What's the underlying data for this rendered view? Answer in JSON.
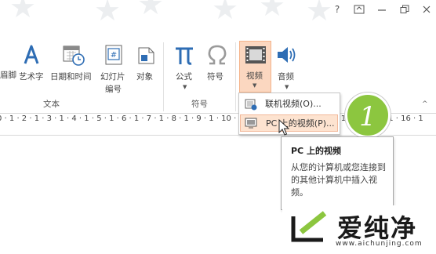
{
  "window": {
    "help": "?"
  },
  "ribbon": {
    "items": [
      {
        "label": "眉脚"
      },
      {
        "label": "艺术字"
      },
      {
        "label": "日期和时间"
      },
      {
        "label_line1": "幻灯片",
        "label_line2": "编号"
      },
      {
        "label": "对象"
      },
      {
        "label": "公式"
      },
      {
        "label": "符号"
      },
      {
        "label": "视频"
      },
      {
        "label": "音频"
      }
    ],
    "groups": {
      "text": "文本",
      "symbols": "符号"
    }
  },
  "ruler": {
    "text": "0 · 1 · 2 · 1 · 3 · 1 · 4 · 1 · 5 · 1 · 6 · 1 · 7 · 1 · 8 · 1 · 9 · 1 · 10 · 1 · 11 · 1 · 12 · 1 · 13 · 1 · 14 · 1 · 15 · 1 · 16 · 1"
  },
  "menu": {
    "items": [
      {
        "label": "联机视频(O)..."
      },
      {
        "label": "PC 上的视频(P)..."
      }
    ]
  },
  "tooltip": {
    "title": "PC 上的视频",
    "body": "从您的计算机或您连接到的其他计算机中插入视频。"
  },
  "badge": {
    "number": "1"
  },
  "watermark": {
    "text": "爱纯净",
    "url": "www.aichunjing.com"
  },
  "colors": {
    "accent_green": "#8cc63f",
    "video_highlight": "#fbd7c0",
    "icon_blue": "#2e6db4"
  }
}
